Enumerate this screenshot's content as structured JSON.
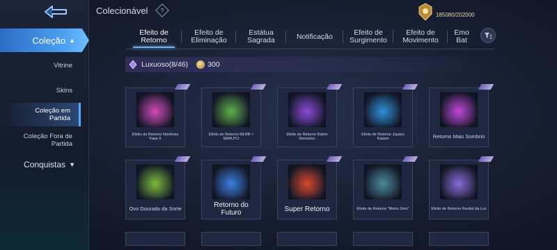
{
  "header": {
    "title": "Colecionável",
    "points_text": "185080/202000"
  },
  "sidebar": {
    "main": [
      {
        "label": "Coleção",
        "state": "active"
      },
      {
        "label": "Conquistas",
        "state": "collapsed"
      }
    ],
    "items": [
      {
        "label": "Vitrine"
      },
      {
        "label": "Skins"
      },
      {
        "label": "Coleção em Partida",
        "state": "active"
      },
      {
        "label": "Coleção Fora de Partida"
      }
    ]
  },
  "tabs": [
    {
      "label": "Efeito de Retorno",
      "active": true
    },
    {
      "label": "Efeito de Eliminação"
    },
    {
      "label": "Estátua Sagrada"
    },
    {
      "label": "Notificação"
    },
    {
      "label": "Efeito de Surgimento"
    },
    {
      "label": "Efeito de Movimento"
    },
    {
      "label": "Emo Bat"
    }
  ],
  "section": {
    "label": "Luxuoso(8/46)",
    "cost": "300"
  },
  "cards": [
    {
      "label": "Efeito de Retorno Neoferas Fase II",
      "size": "small",
      "icon": "neobeasts-recall-icon",
      "color": "#d24ab8"
    },
    {
      "label": "Efeito de Retorno MLBB × NARUTO",
      "size": "small",
      "icon": "naruto-recall-icon",
      "color": "#5fae4a"
    },
    {
      "label": "Efeito de Retorno Kishin Densetsu",
      "size": "small",
      "icon": "kishin-recall-icon",
      "color": "#8a4ad6"
    },
    {
      "label": "Efeito de Retorno Jujutsu Kaisen",
      "size": "small",
      "icon": "jujutsu-recall-icon",
      "color": "#2f8fd6"
    },
    {
      "label": "Retorno Mais Sombrio",
      "size": "mid",
      "icon": "darkest-recall-icon",
      "color": "#c247d8"
    },
    {
      "label": "Ovo Dourado da Sorte",
      "size": "mid",
      "icon": "golden-egg-recall-icon",
      "color": "#7dbb3a"
    },
    {
      "label": "Retorno do Futuro",
      "size": "big",
      "icon": "future-recall-icon",
      "color": "#3a7fe0"
    },
    {
      "label": "Super Retorno",
      "size": "big",
      "icon": "super-recall-icon",
      "color": "#d6482a"
    },
    {
      "label": "Efeito de Retorno \"Metro Zero\"",
      "size": "small",
      "icon": "metro-zero-recall-icon",
      "color": "#4a8a9a"
    },
    {
      "label": "Efeito de Retorno Recital da Luz",
      "size": "small",
      "icon": "recital-light-recall-icon",
      "color": "#8a6ad6"
    }
  ],
  "colors": {
    "accent": "#4a9ef0",
    "tab_underline": "#6ab7ff"
  }
}
